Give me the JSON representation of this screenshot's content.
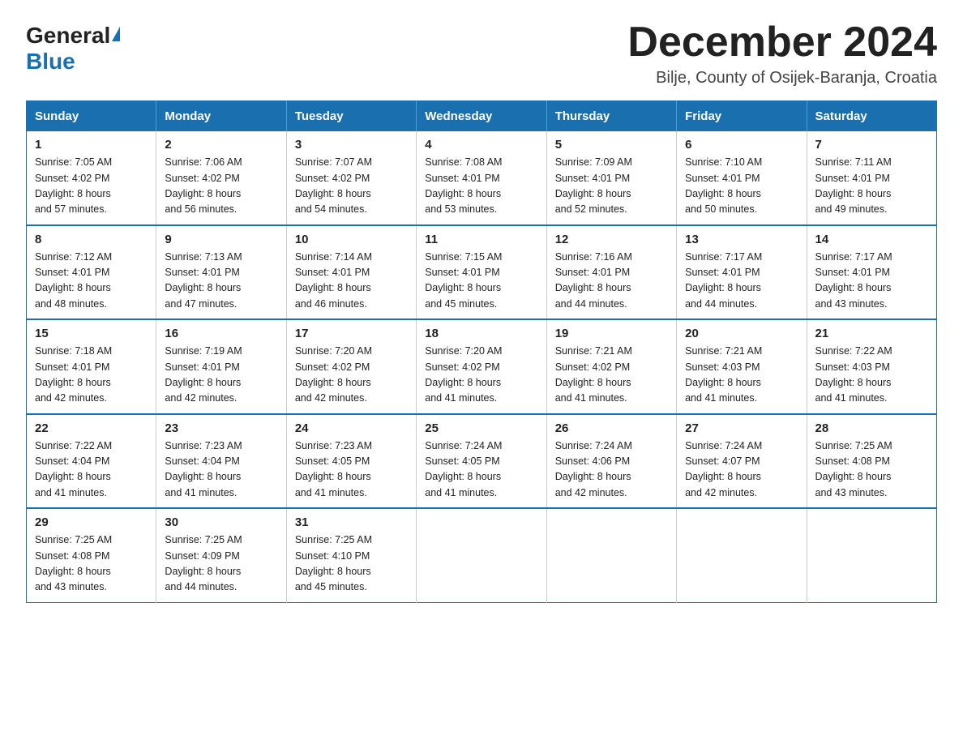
{
  "logo": {
    "general": "General",
    "blue": "Blue"
  },
  "header": {
    "month_year": "December 2024",
    "location": "Bilje, County of Osijek-Baranja, Croatia"
  },
  "weekdays": [
    "Sunday",
    "Monday",
    "Tuesday",
    "Wednesday",
    "Thursday",
    "Friday",
    "Saturday"
  ],
  "weeks": [
    [
      {
        "day": "1",
        "sunrise": "7:05 AM",
        "sunset": "4:02 PM",
        "daylight": "8 hours and 57 minutes."
      },
      {
        "day": "2",
        "sunrise": "7:06 AM",
        "sunset": "4:02 PM",
        "daylight": "8 hours and 56 minutes."
      },
      {
        "day": "3",
        "sunrise": "7:07 AM",
        "sunset": "4:02 PM",
        "daylight": "8 hours and 54 minutes."
      },
      {
        "day": "4",
        "sunrise": "7:08 AM",
        "sunset": "4:01 PM",
        "daylight": "8 hours and 53 minutes."
      },
      {
        "day": "5",
        "sunrise": "7:09 AM",
        "sunset": "4:01 PM",
        "daylight": "8 hours and 52 minutes."
      },
      {
        "day": "6",
        "sunrise": "7:10 AM",
        "sunset": "4:01 PM",
        "daylight": "8 hours and 50 minutes."
      },
      {
        "day": "7",
        "sunrise": "7:11 AM",
        "sunset": "4:01 PM",
        "daylight": "8 hours and 49 minutes."
      }
    ],
    [
      {
        "day": "8",
        "sunrise": "7:12 AM",
        "sunset": "4:01 PM",
        "daylight": "8 hours and 48 minutes."
      },
      {
        "day": "9",
        "sunrise": "7:13 AM",
        "sunset": "4:01 PM",
        "daylight": "8 hours and 47 minutes."
      },
      {
        "day": "10",
        "sunrise": "7:14 AM",
        "sunset": "4:01 PM",
        "daylight": "8 hours and 46 minutes."
      },
      {
        "day": "11",
        "sunrise": "7:15 AM",
        "sunset": "4:01 PM",
        "daylight": "8 hours and 45 minutes."
      },
      {
        "day": "12",
        "sunrise": "7:16 AM",
        "sunset": "4:01 PM",
        "daylight": "8 hours and 44 minutes."
      },
      {
        "day": "13",
        "sunrise": "7:17 AM",
        "sunset": "4:01 PM",
        "daylight": "8 hours and 44 minutes."
      },
      {
        "day": "14",
        "sunrise": "7:17 AM",
        "sunset": "4:01 PM",
        "daylight": "8 hours and 43 minutes."
      }
    ],
    [
      {
        "day": "15",
        "sunrise": "7:18 AM",
        "sunset": "4:01 PM",
        "daylight": "8 hours and 42 minutes."
      },
      {
        "day": "16",
        "sunrise": "7:19 AM",
        "sunset": "4:01 PM",
        "daylight": "8 hours and 42 minutes."
      },
      {
        "day": "17",
        "sunrise": "7:20 AM",
        "sunset": "4:02 PM",
        "daylight": "8 hours and 42 minutes."
      },
      {
        "day": "18",
        "sunrise": "7:20 AM",
        "sunset": "4:02 PM",
        "daylight": "8 hours and 41 minutes."
      },
      {
        "day": "19",
        "sunrise": "7:21 AM",
        "sunset": "4:02 PM",
        "daylight": "8 hours and 41 minutes."
      },
      {
        "day": "20",
        "sunrise": "7:21 AM",
        "sunset": "4:03 PM",
        "daylight": "8 hours and 41 minutes."
      },
      {
        "day": "21",
        "sunrise": "7:22 AM",
        "sunset": "4:03 PM",
        "daylight": "8 hours and 41 minutes."
      }
    ],
    [
      {
        "day": "22",
        "sunrise": "7:22 AM",
        "sunset": "4:04 PM",
        "daylight": "8 hours and 41 minutes."
      },
      {
        "day": "23",
        "sunrise": "7:23 AM",
        "sunset": "4:04 PM",
        "daylight": "8 hours and 41 minutes."
      },
      {
        "day": "24",
        "sunrise": "7:23 AM",
        "sunset": "4:05 PM",
        "daylight": "8 hours and 41 minutes."
      },
      {
        "day": "25",
        "sunrise": "7:24 AM",
        "sunset": "4:05 PM",
        "daylight": "8 hours and 41 minutes."
      },
      {
        "day": "26",
        "sunrise": "7:24 AM",
        "sunset": "4:06 PM",
        "daylight": "8 hours and 42 minutes."
      },
      {
        "day": "27",
        "sunrise": "7:24 AM",
        "sunset": "4:07 PM",
        "daylight": "8 hours and 42 minutes."
      },
      {
        "day": "28",
        "sunrise": "7:25 AM",
        "sunset": "4:08 PM",
        "daylight": "8 hours and 43 minutes."
      }
    ],
    [
      {
        "day": "29",
        "sunrise": "7:25 AM",
        "sunset": "4:08 PM",
        "daylight": "8 hours and 43 minutes."
      },
      {
        "day": "30",
        "sunrise": "7:25 AM",
        "sunset": "4:09 PM",
        "daylight": "8 hours and 44 minutes."
      },
      {
        "day": "31",
        "sunrise": "7:25 AM",
        "sunset": "4:10 PM",
        "daylight": "8 hours and 45 minutes."
      },
      null,
      null,
      null,
      null
    ]
  ],
  "labels": {
    "sunrise": "Sunrise:",
    "sunset": "Sunset:",
    "daylight": "Daylight:"
  }
}
